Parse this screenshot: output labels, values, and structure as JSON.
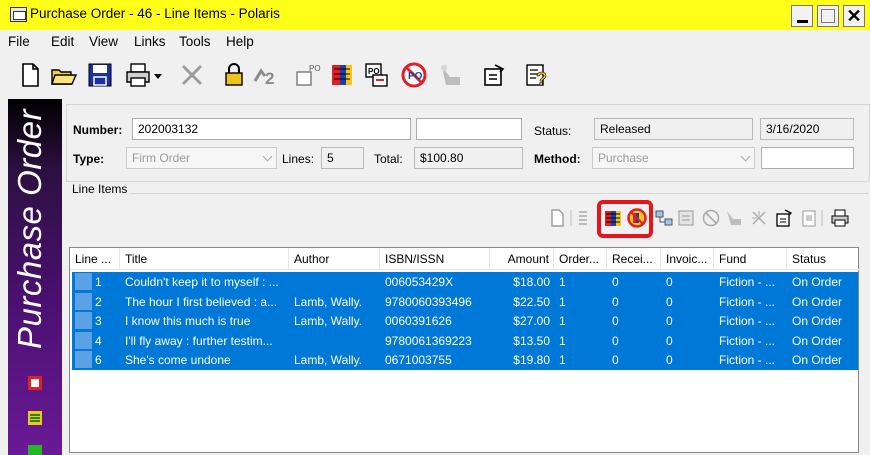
{
  "window": {
    "title": "Purchase Order - 46 - Line Items - Polaris",
    "close_glyph": "✕"
  },
  "menu": [
    "File",
    "Edit",
    "View",
    "Links",
    "Tools",
    "Help"
  ],
  "toolbar": [
    "new-icon",
    "open-icon",
    "save-icon",
    "print-icon",
    "dropdown-arrow-icon",
    "delete-icon",
    "lock-icon",
    "assign-icon",
    "po-icon",
    "receive-icon",
    "invoice-icon",
    "cancel-icon",
    "route-icon",
    "properties-icon",
    "help-icon"
  ],
  "sidebar": {
    "title": "Purchase Order"
  },
  "header": {
    "number_label": "Number:",
    "number_value": "202003132",
    "type_label": "Type:",
    "type_value": "Firm Order",
    "lines_label": "Lines:",
    "lines_value": "5",
    "total_label": "Total:",
    "total_value": "$100.80",
    "status_label": "Status:",
    "status_value": "Released",
    "date_value": "3/16/2020",
    "method_label": "Method:",
    "method_value": "Purchase"
  },
  "line_items": {
    "caption": "Line Items",
    "columns": [
      "Line ...",
      "Title",
      "Author",
      "ISBN/ISSN",
      "Amount",
      "Order...",
      "Recei...",
      "Invoic...",
      "Fund",
      "Status"
    ],
    "rows": [
      {
        "line": "1",
        "title": "Couldn't keep it to myself : ...",
        "author": "",
        "isbn": "006053429X",
        "amount": "$18.00",
        "order": "1",
        "received": "0",
        "invoiced": "0",
        "fund": "Fiction - ...",
        "status": "On Order"
      },
      {
        "line": "2",
        "title": "The hour I first believed : a...",
        "author": "Lamb, Wally.",
        "isbn": "9780060393496",
        "amount": "$22.50",
        "order": "1",
        "received": "0",
        "invoiced": "0",
        "fund": "Fiction - ...",
        "status": "On Order"
      },
      {
        "line": "3",
        "title": "I know this much is true",
        "author": "Lamb, Wally.",
        "isbn": "0060391626",
        "amount": "$27.00",
        "order": "1",
        "received": "0",
        "invoiced": "0",
        "fund": "Fiction - ...",
        "status": "On Order"
      },
      {
        "line": "4",
        "title": "I'll fly away : further testim...",
        "author": "",
        "isbn": "9780061369223",
        "amount": "$13.50",
        "order": "1",
        "received": "0",
        "invoiced": "0",
        "fund": "Fiction - ...",
        "status": "On Order"
      },
      {
        "line": "6",
        "title": "She's come undone",
        "author": "Lamb, Wally.",
        "isbn": "0671003755",
        "amount": "$19.80",
        "order": "1",
        "received": "0",
        "invoiced": "0",
        "fund": "Fiction - ...",
        "status": "On Order"
      }
    ]
  },
  "colors": {
    "title_bar": "#ffff1a",
    "selection": "#0078d7",
    "highlight": "#e8141c",
    "sidebar": "#6a1a96"
  }
}
